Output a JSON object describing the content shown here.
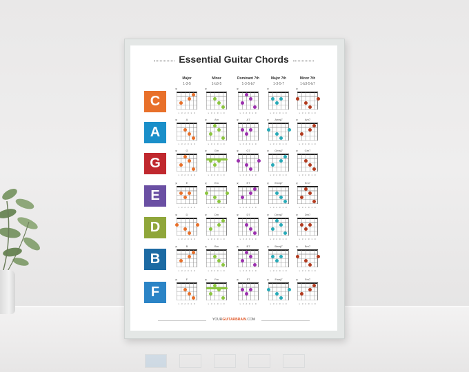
{
  "poster": {
    "title": "Essential Guitar Chords",
    "columns": [
      {
        "name": "Major",
        "formula": "1-3-5"
      },
      {
        "name": "Minor",
        "formula": "1-b3-5"
      },
      {
        "name": "Dominant 7th",
        "formula": "1-3-5-b7"
      },
      {
        "name": "Major 7th",
        "formula": "1-3-5-7"
      },
      {
        "name": "Minor 7th",
        "formula": "1-b3-5-b7"
      }
    ],
    "rows": [
      {
        "letter": "C",
        "color": "#e8702a",
        "chords": [
          "C",
          "Cm",
          "C7",
          "Cmaj7",
          "Cm7"
        ]
      },
      {
        "letter": "A",
        "color": "#1a8fc9",
        "chords": [
          "A",
          "Am",
          "A7",
          "Amaj7",
          "Am7"
        ]
      },
      {
        "letter": "G",
        "color": "#c0282e",
        "chords": [
          "G",
          "Gm",
          "G7",
          "Gmaj7",
          "Gm7"
        ]
      },
      {
        "letter": "E",
        "color": "#6a4fa3",
        "chords": [
          "E",
          "Em",
          "E7",
          "Emaj7",
          "Em7"
        ]
      },
      {
        "letter": "D",
        "color": "#8fa63a",
        "chords": [
          "D",
          "Dm",
          "D7",
          "Dmaj7",
          "Dm7"
        ]
      },
      {
        "letter": "B",
        "color": "#1c6aa3",
        "chords": [
          "B",
          "Bm",
          "B7",
          "Bmaj7",
          "Bm7"
        ]
      },
      {
        "letter": "F",
        "color": "#2b84c6",
        "chords": [
          "F",
          "Fm",
          "F7",
          "Fmaj7",
          "Fm7"
        ]
      }
    ],
    "column_colors": [
      "#e8702a",
      "#8cc63f",
      "#9b2fae",
      "#27aab8",
      "#b23a1e"
    ],
    "fingering": "x 3 2 0 1 0",
    "footer_prefix": "YOUR",
    "footer_brand": "GUITARBRAIN",
    "footer_suffix": ".COM"
  }
}
